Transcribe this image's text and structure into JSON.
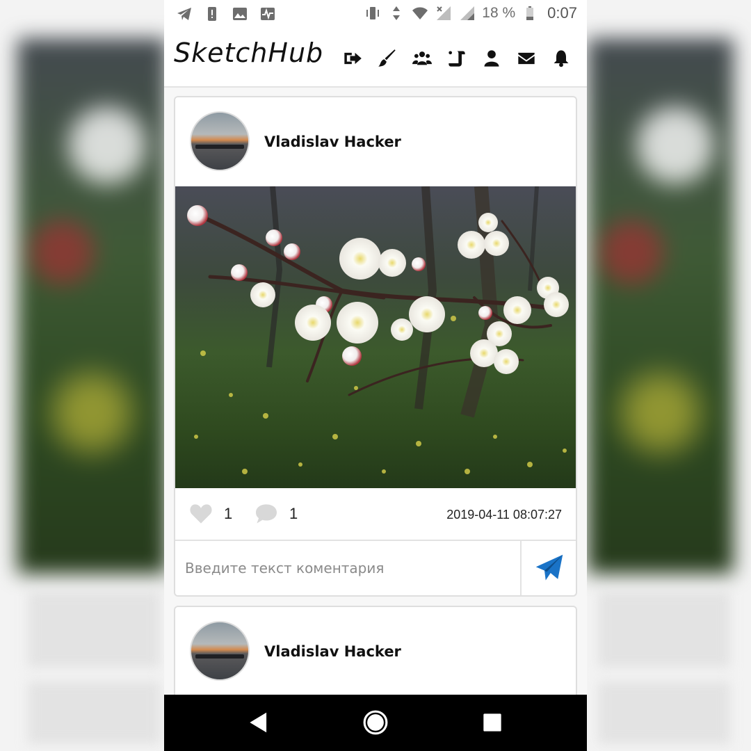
{
  "status_bar": {
    "battery_percent": "18 %",
    "time": "0:07",
    "left_icons": [
      "telegram-icon",
      "alert-icon",
      "image-icon",
      "activity-icon"
    ],
    "right_icons": [
      "vibrate-icon",
      "data-arrows-icon",
      "wifi-icon",
      "signal-x-icon",
      "signal-icon",
      "battery-icon"
    ]
  },
  "header": {
    "logo": "SketchHub",
    "nav_icons": [
      "logout-icon",
      "brush-icon",
      "users-icon",
      "scroll-icon",
      "user-icon",
      "envelope-icon",
      "bell-icon"
    ]
  },
  "posts": [
    {
      "author": "Vladislav Hacker",
      "likes": "1",
      "comments": "1",
      "date": "2019-04-11 08:07:27",
      "comment_placeholder": "Введите текст коментария"
    },
    {
      "author": "Vladislav Hacker"
    }
  ],
  "colors": {
    "accent": "#1a73c7",
    "stat_icon": "#d8d8d8",
    "nav_bar": "#000000"
  }
}
